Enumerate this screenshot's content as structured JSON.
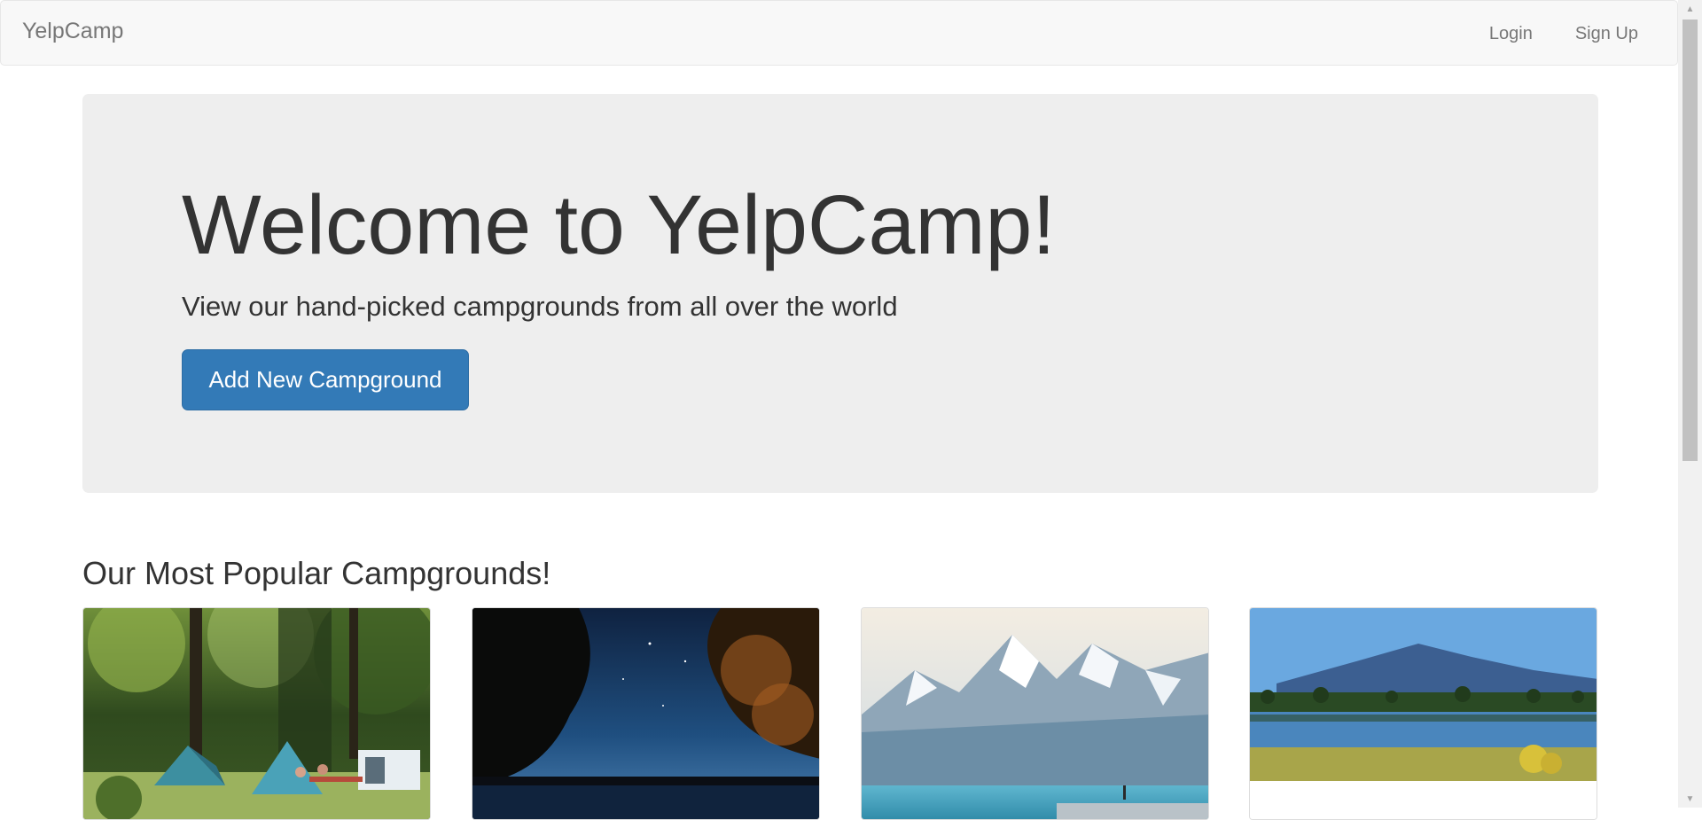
{
  "navbar": {
    "brand": "YelpCamp",
    "links": [
      {
        "label": "Login"
      },
      {
        "label": "Sign Up"
      }
    ]
  },
  "jumbotron": {
    "title": "Welcome to YelpCamp!",
    "subtitle": "View our hand-picked campgrounds from all over the world",
    "button_label": "Add New Campground"
  },
  "popular": {
    "heading": "Our Most Popular Campgrounds!",
    "cards": [
      {
        "image": "forest-campsite-tents-photo"
      },
      {
        "image": "night-sky-lake-trees-photo"
      },
      {
        "image": "glacier-lake-mountains-photo"
      },
      {
        "image": "mountain-lake-reflection-photo"
      }
    ]
  },
  "colors": {
    "primary": "#337ab7",
    "navbar_bg": "#f8f8f8",
    "jumbotron_bg": "#eeeeee",
    "text": "#333333",
    "nav_text": "#777777"
  }
}
